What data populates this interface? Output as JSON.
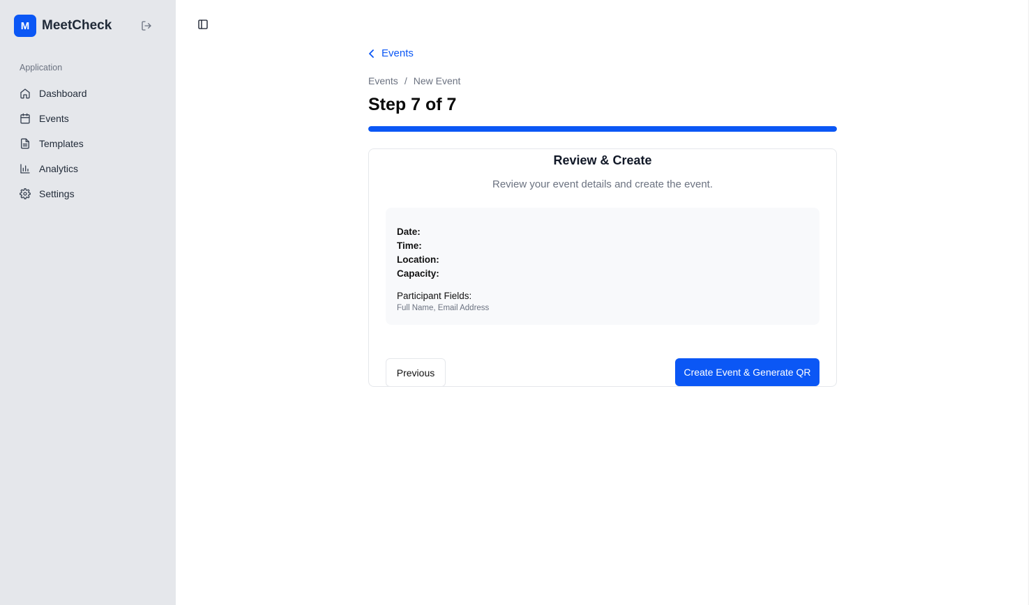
{
  "app": {
    "logo_letter": "M",
    "name": "MeetCheck"
  },
  "sidebar": {
    "section_label": "Application",
    "items": [
      {
        "label": "Dashboard",
        "icon": "home-icon"
      },
      {
        "label": "Events",
        "icon": "calendar-icon"
      },
      {
        "label": "Templates",
        "icon": "document-icon"
      },
      {
        "label": "Analytics",
        "icon": "bar-chart-icon"
      },
      {
        "label": "Settings",
        "icon": "gear-icon"
      }
    ]
  },
  "header": {
    "back_link": "Events",
    "breadcrumb": [
      "Events",
      "New Event"
    ],
    "breadcrumb_separator": "/",
    "title": "Step 7 of 7",
    "progress_fraction": 1.0
  },
  "card": {
    "title": "Review & Create",
    "subtitle": "Review your event details and create the event.",
    "review": {
      "date_label": "Date:",
      "date_value": "",
      "time_label": "Time:",
      "time_value": "",
      "location_label": "Location:",
      "location_value": "",
      "capacity_label": "Capacity:",
      "capacity_value": "",
      "fields_label": "Participant Fields:",
      "fields_value": "Full Name, Email Address"
    },
    "previous_label": "Previous",
    "create_label": "Create Event & Generate QR"
  },
  "colors": {
    "accent": "#0b57f5",
    "sidebar_bg": "#e5e7eb",
    "review_bg": "#f8f9fb"
  }
}
